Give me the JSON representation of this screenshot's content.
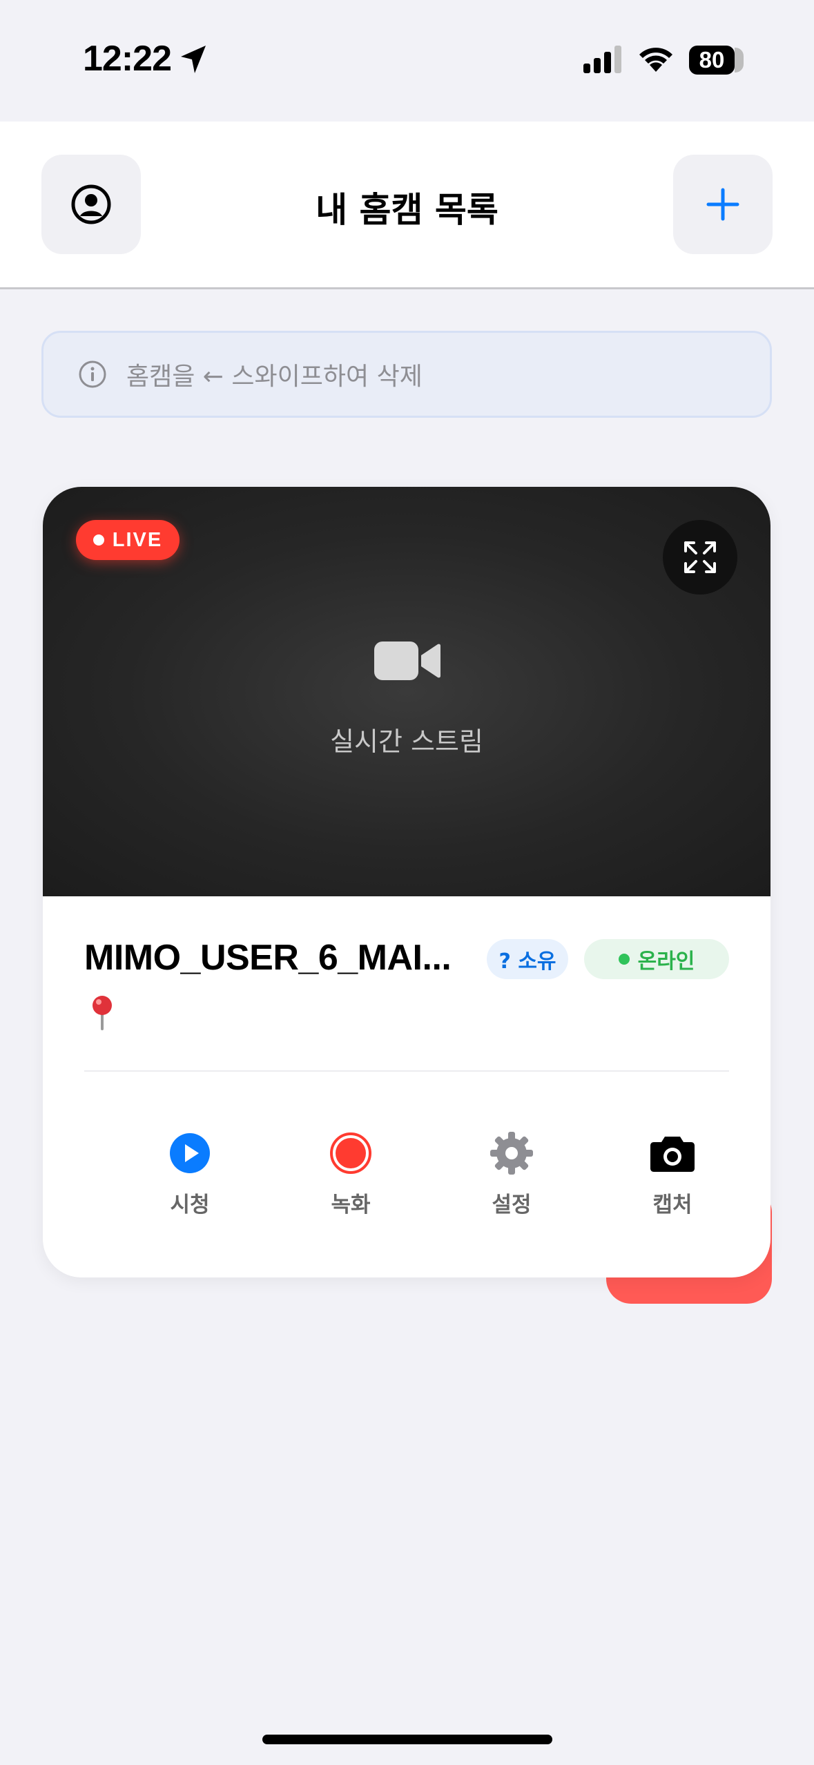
{
  "status_bar": {
    "time": "12:22",
    "battery": "80"
  },
  "nav": {
    "title": "내 홈캠 목록",
    "profile_icon": "person-circle-icon",
    "add_icon": "plus-icon"
  },
  "hint": {
    "text": "홈캠을 ← 스와이프하여 삭제",
    "icon": "info-icon"
  },
  "camera": {
    "live_label": "LIVE",
    "stream_caption": "실시간 스트림",
    "name": "MIMO_USER_6_MAI...",
    "owner_badge": "? 소유",
    "status_badge": "온라인",
    "location_icon": "pin-icon",
    "actions": [
      {
        "label": "시청",
        "icon": "play-circle-icon"
      },
      {
        "label": "녹화",
        "icon": "record-icon"
      },
      {
        "label": "설정",
        "icon": "gear-icon"
      },
      {
        "label": "캡처",
        "icon": "camera-icon"
      }
    ]
  },
  "colors": {
    "accent_blue": "#0a7cff",
    "live_red": "#ff3b30",
    "online_green": "#2fc35a",
    "delete_red": "#ff5a55"
  }
}
